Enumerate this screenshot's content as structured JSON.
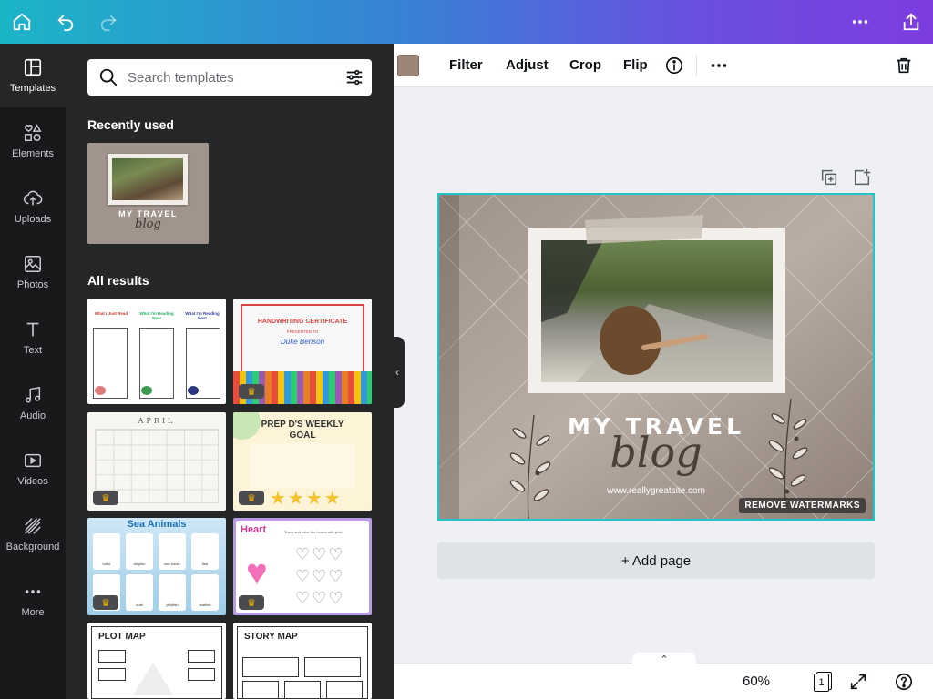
{
  "topbar": {
    "icons": [
      "home-icon",
      "undo-icon",
      "redo-icon",
      "more-icon",
      "share-icon"
    ]
  },
  "rail": {
    "items": [
      {
        "label": "Templates",
        "icon": "templates-icon"
      },
      {
        "label": "Elements",
        "icon": "elements-icon"
      },
      {
        "label": "Uploads",
        "icon": "upload-icon"
      },
      {
        "label": "Photos",
        "icon": "photos-icon"
      },
      {
        "label": "Text",
        "icon": "text-icon"
      },
      {
        "label": "Audio",
        "icon": "audio-icon"
      },
      {
        "label": "Videos",
        "icon": "videos-icon"
      },
      {
        "label": "Background",
        "icon": "background-icon"
      },
      {
        "label": "More",
        "icon": "more-icon"
      }
    ]
  },
  "panel": {
    "search_placeholder": "Search templates",
    "recently_used_title": "Recently used",
    "recent": {
      "title": "MY TRAVEL",
      "script": "blog"
    },
    "all_results_title": "All results",
    "results": [
      {
        "title": "What I Just Read / What I'm Reading Now / What I'm Reading Next",
        "labels": [
          "What I Just Read",
          "What I'm Reading Now",
          "What I'm Reading Next"
        ],
        "premium": false
      },
      {
        "title": "HANDWRITING CERTIFICATE",
        "sub": "PRESENTED TO",
        "name": "Duke Benson",
        "premium": true
      },
      {
        "title": "APRIL",
        "premium": true
      },
      {
        "title": "PREP D'S WEEKLY GOAL",
        "premium": true
      },
      {
        "title": "Sea Animals",
        "labels": [
          "turtle",
          "dolphin",
          "sea horse",
          "fish",
          "crab",
          "jellyfish",
          "starfish"
        ],
        "premium": true
      },
      {
        "title": "Heart",
        "sub": "Trace and color the hearts with pink.",
        "premium": true
      },
      {
        "title": "PLOT MAP",
        "premium": false
      },
      {
        "title": "STORY MAP",
        "premium": false
      }
    ]
  },
  "toolbar": {
    "swatch_color": "#9a8577",
    "filter": "Filter",
    "adjust": "Adjust",
    "crop": "Crop",
    "flip": "Flip"
  },
  "design": {
    "title": "MY TRAVEL",
    "script": "blog",
    "url": "www.reallygreatsite.com",
    "watermark_button": "REMOVE WATERMARKS"
  },
  "canvas": {
    "add_page": "+ Add page"
  },
  "bottombar": {
    "zoom": "60%",
    "page_count": "1"
  },
  "colors": {
    "accent": "#20c4cb",
    "rail_bg": "#18191b",
    "panel_bg": "#252627"
  }
}
